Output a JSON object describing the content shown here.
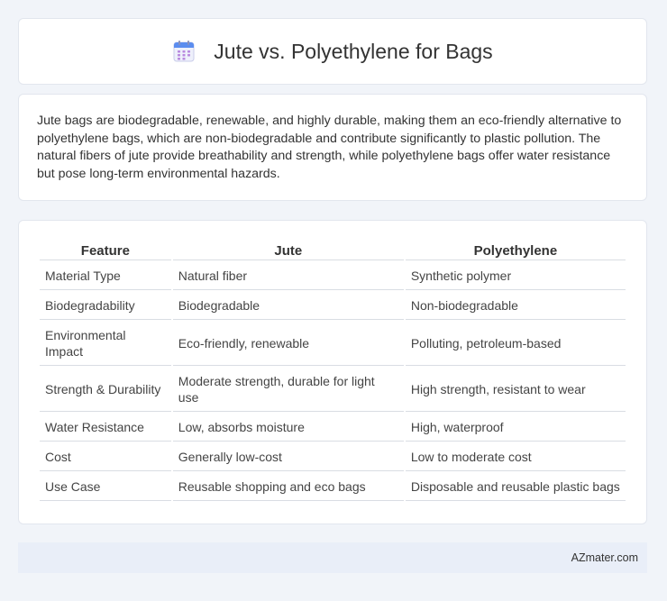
{
  "header": {
    "icon": "calendar-icon",
    "title": "Jute vs. Polyethylene for Bags"
  },
  "summary": {
    "text": "Jute bags are biodegradable, renewable, and highly durable, making them an eco-friendly alternative to polyethylene bags, which are non-biodegradable and contribute significantly to plastic pollution. The natural fibers of jute provide breathability and strength, while polyethylene bags offer water resistance but pose long-term environmental hazards."
  },
  "table": {
    "headers": [
      "Feature",
      "Jute",
      "Polyethylene"
    ],
    "rows": [
      [
        "Material Type",
        "Natural fiber",
        "Synthetic polymer"
      ],
      [
        "Biodegradability",
        "Biodegradable",
        "Non-biodegradable"
      ],
      [
        "Environmental Impact",
        "Eco-friendly, renewable",
        "Polluting, petroleum-based"
      ],
      [
        "Strength & Durability",
        "Moderate strength, durable for light use",
        "High strength, resistant to wear"
      ],
      [
        "Water Resistance",
        "Low, absorbs moisture",
        "High, waterproof"
      ],
      [
        "Cost",
        "Generally low-cost",
        "Low to moderate cost"
      ],
      [
        "Use Case",
        "Reusable shopping and eco bags",
        "Disposable and reusable plastic bags"
      ]
    ]
  },
  "footer": {
    "brand": "AZmater.com"
  }
}
